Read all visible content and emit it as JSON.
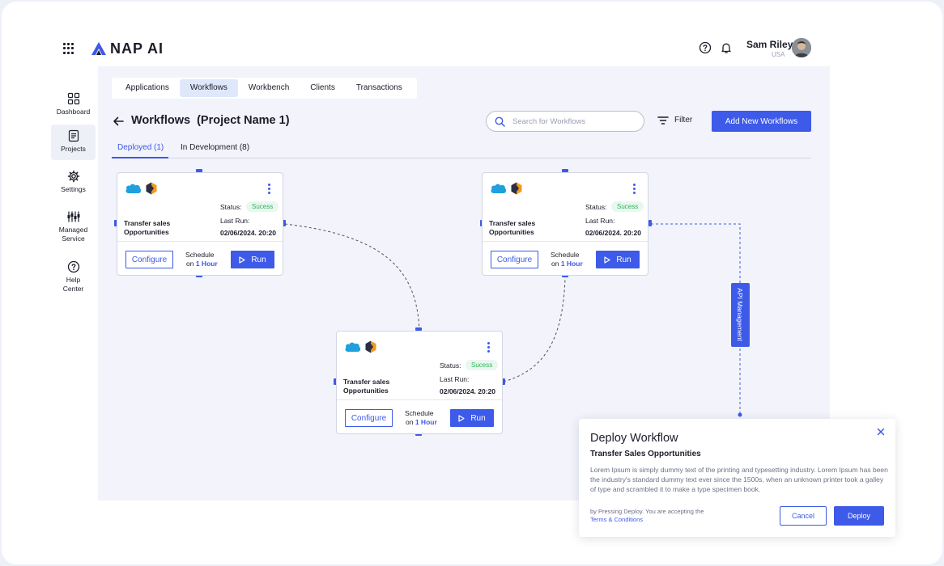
{
  "header": {
    "brand": "NAP AI",
    "user": {
      "name": "Sam Riley",
      "country": "USA"
    },
    "icons": {
      "apps": "grid-icon",
      "help": "help-circle-icon",
      "notifications": "bell-icon"
    }
  },
  "sidebar": {
    "items": [
      {
        "label": "Dashboard",
        "icon": "dashboard-icon",
        "active": false
      },
      {
        "label": "Projects",
        "icon": "projects-icon",
        "active": true
      },
      {
        "label": "Settings",
        "icon": "gear-icon",
        "active": false
      },
      {
        "label": "Managed\nService",
        "label_line1": "Managed",
        "label_line2": "Service",
        "icon": "sliders-icon",
        "active": false
      },
      {
        "label_line1": "Help",
        "label_line2": "Center",
        "icon": "help-circle-icon",
        "active": false
      }
    ]
  },
  "tabs": [
    {
      "label": "Applications",
      "active": false
    },
    {
      "label": "Workflows",
      "active": true
    },
    {
      "label": "Workbench",
      "active": false
    },
    {
      "label": "Clients",
      "active": false
    },
    {
      "label": "Transactions",
      "active": false
    }
  ],
  "page": {
    "title": "Workflows  (Project Name 1)",
    "search_placeholder": "Search for Workflows",
    "filter_label": "Filter",
    "add_button": "Add New Workflows",
    "subtabs": [
      {
        "label": "Deployed (1)",
        "active": true
      },
      {
        "label": "In Development (8)",
        "active": false
      }
    ]
  },
  "workflows": [
    {
      "name": "Transfer sales Opportunities",
      "status_label": "Status:",
      "status": "Sucess",
      "last_run_label": "Last Run:",
      "last_run": "02/06/2024. 20:20",
      "configure_label": "Configure",
      "schedule_label": "Schedule",
      "schedule_prefix": "on",
      "schedule_value": "1 Hour",
      "run_label": "Run"
    },
    {
      "name": "Transfer sales Opportunities",
      "status_label": "Status:",
      "status": "Sucess",
      "last_run_label": "Last Run:",
      "last_run": "02/06/2024. 20:20",
      "configure_label": "Configure",
      "schedule_label": "Schedule",
      "schedule_prefix": "on",
      "schedule_value": "1 Hour",
      "run_label": "Run"
    },
    {
      "name": "Transfer sales Opportunities",
      "status_label": "Status:",
      "status": "Sucess",
      "last_run_label": "Last Run:",
      "last_run": "02/06/2024. 20:20",
      "configure_label": "Configure",
      "schedule_label": "Schedule",
      "schedule_prefix": "on",
      "schedule_value": "1 Hour",
      "run_label": "Run"
    }
  ],
  "api_tag": "API Management",
  "modal": {
    "title": "Deploy Workflow",
    "subtitle": "Transfer Sales Opportunities",
    "body": "Lorem Ipsum is simply dummy text of the printing and typesetting industry. Lorem Ipsum has been the industry's standard dummy text ever since the 1500s, when an unknown printer took a galley of type and scrambled it to make a type specimen book.",
    "terms_prefix": "by Pressing Deploy. You are accepting the",
    "terms_link": "Terms & Conditions",
    "cancel": "Cancel",
    "deploy": "Deploy"
  },
  "colors": {
    "accent": "#3d5ae8",
    "success": "#2fb35c",
    "success_bg": "#e8f8ee",
    "canvas": "#f2f3fb"
  }
}
